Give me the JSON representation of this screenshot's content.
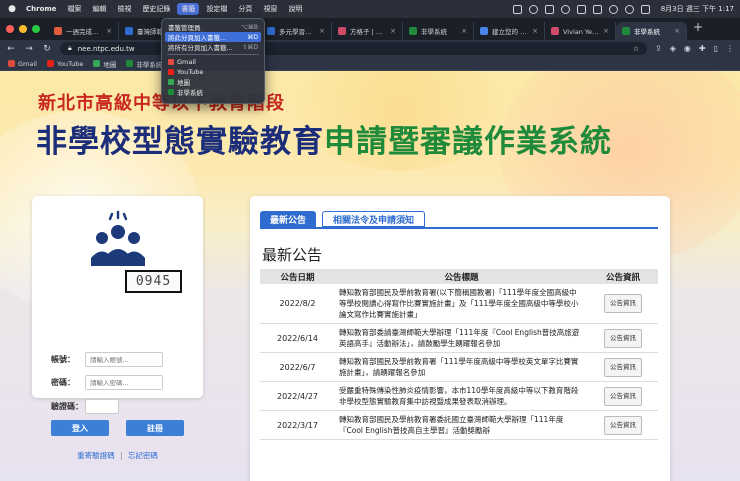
{
  "menubar": {
    "app": "Chrome",
    "items": [
      "檔案",
      "編輯",
      "檢視",
      "歷史記錄",
      "書籤",
      "設定檔",
      "分頁",
      "視窗",
      "說明"
    ],
    "active_index": 4,
    "clock": "8月3日 週三 下午 1:17"
  },
  "tabs": [
    {
      "label": "一週完成自學",
      "color": "#e25b3a"
    },
    {
      "label": "臺灣師範大學",
      "color": "#2f6cd0"
    },
    {
      "label": "",
      "color": "#888888"
    },
    {
      "label": "多元學習資源",
      "color": "#2f6cd0"
    },
    {
      "label": "方格子 | 我的",
      "color": "#d04a6a"
    },
    {
      "label": "非學系統",
      "color": "#1e8a3a"
    },
    {
      "label": "建立您的 Goo",
      "color": "#4a86e8"
    },
    {
      "label": "Vivian Yeh | 方",
      "color": "#d04a6a"
    },
    {
      "label": "非學系統",
      "color": "#1e8a3a"
    }
  ],
  "active_tab_index": 8,
  "address": {
    "url": "nee.ntpc.edu.tw"
  },
  "bookmarks": [
    {
      "label": "Gmail",
      "color": "#e04a3f"
    },
    {
      "label": "YouTube",
      "color": "#e62117"
    },
    {
      "label": "地圖",
      "color": "#34a853"
    },
    {
      "label": "非學系統",
      "color": "#1e8a3a"
    }
  ],
  "bookmark_menu": {
    "items": [
      {
        "label": "書籤管理員",
        "shortcut": "⌥⌘B"
      },
      {
        "label": "將此分頁加入書籤...",
        "shortcut": "⌘D",
        "highlighted": true
      },
      {
        "label": "將所有分頁加入書籤...",
        "shortcut": "⇧⌘D"
      }
    ],
    "links": [
      {
        "label": "Gmail",
        "color": "#e04a3f"
      },
      {
        "label": "YouTube",
        "color": "#e62117"
      },
      {
        "label": "地圖",
        "color": "#34a853"
      },
      {
        "label": "非學系統",
        "color": "#1e8a3a"
      }
    ]
  },
  "header": {
    "subtitle": "新北市高級中等以下教育階段",
    "title_part1": "非學校型態實驗教育",
    "title_part2": "申請暨審議作業系統"
  },
  "login": {
    "account_label": "帳號：",
    "account_placeholder": "請輸入帳號...",
    "password_label": "密碼：",
    "password_placeholder": "請輸入密碼...",
    "captcha_label": "驗證碼：",
    "captcha_text": "0945",
    "login_button": "登入",
    "register_button": "註冊",
    "resend_link": "重寄驗證碼",
    "separator": "|",
    "forgot_link": "忘記密碼"
  },
  "announcements": {
    "tab_active": "最新公告",
    "tab_other": "相關法令及申請須知",
    "section_title": "最新公告",
    "columns": [
      "公告日期",
      "公告標題",
      "公告資訊"
    ],
    "info_button": "公告資訊",
    "rows": [
      {
        "date": "2022/8/2",
        "title": "轉知教育部國民及學前教育署(以下簡稱國教署)「111學年度全國高級中等學校閱讀心得寫作比賽實施計畫」及「111學年度全國高級中等學校小論文寫作比賽實施計畫」"
      },
      {
        "date": "2022/6/14",
        "title": "轉知教育部委請臺灣師範大學辦理「111年度『Cool English普技高旅遊英語高手』活動辦法」，請鼓勵學生踴躍報名參加"
      },
      {
        "date": "2022/6/7",
        "title": "轉知教育部國民及學前教育署「111學年度高級中等學校英文單字比賽實施計畫」，請踴躍報名參加"
      },
      {
        "date": "2022/4/27",
        "title": "受嚴重特殊傳染性肺炎疫情影響，本市110學年度高級中等以下教育階段非學校型態實驗教育集中訪視暨成果發表取消辦理。"
      },
      {
        "date": "2022/3/17",
        "title": "轉知教育部國民及學前教育署委託國立臺灣師範大學辦理「111年度『Cool English普技高自主學習』活動獎勵辦"
      }
    ]
  }
}
